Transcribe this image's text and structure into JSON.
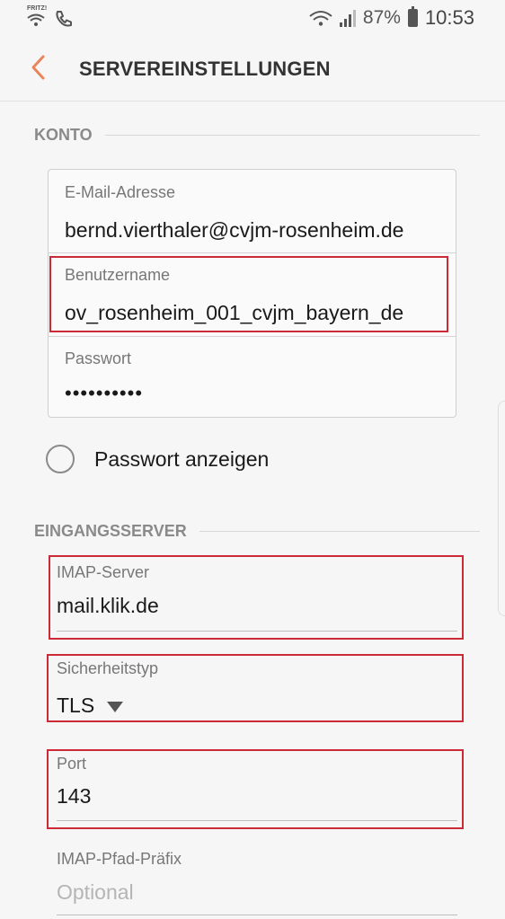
{
  "status_bar": {
    "wifi_label": "FRITZ!",
    "battery": "87%",
    "time": "10:53"
  },
  "header": {
    "title": "SERVEREINSTELLUNGEN"
  },
  "account_section": {
    "title": "KONTO",
    "email_label": "E-Mail-Adresse",
    "email_value": "bernd.vierthaler@cvjm-rosenheim.de",
    "username_label": "Benutzername",
    "username_value": "ov_rosenheim_001_cvjm_bayern_de",
    "password_label": "Passwort",
    "password_value": "••••••••••",
    "show_password_label": "Passwort anzeigen"
  },
  "incoming_section": {
    "title": "EINGANGSSERVER",
    "imap_server_label": "IMAP-Server",
    "imap_server_value": "mail.klik.de",
    "security_label": "Sicherheitstyp",
    "security_value": "TLS",
    "port_label": "Port",
    "port_value": "143",
    "prefix_label": "IMAP-Pfad-Präfix",
    "prefix_placeholder": "Optional"
  },
  "colors": {
    "accent": "#e8855b",
    "highlight": "#cc2a36"
  }
}
